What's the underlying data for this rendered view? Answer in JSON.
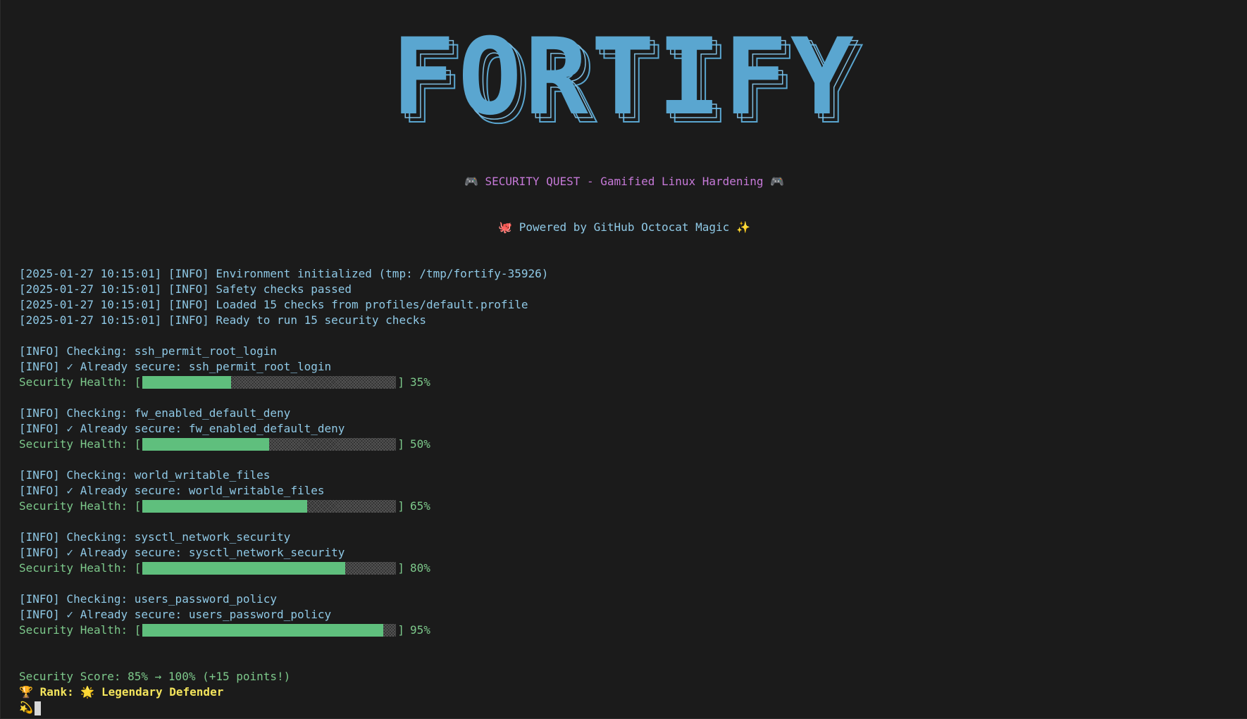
{
  "banner": {
    "title": "FORTIFY"
  },
  "subtitle": {
    "quest_icon_left": "🎮",
    "quest_text": "SECURITY QUEST - Gamified Linux Hardening",
    "quest_icon_right": "🎮",
    "powered_icon_left": "🐙",
    "powered_text": "Powered by GitHub Octocat Magic",
    "powered_icon_right": "✨"
  },
  "init_logs": [
    "[2025-01-27 10:15:01] [INFO] Environment initialized (tmp: /tmp/fortify-35926)",
    "[2025-01-27 10:15:01] [INFO] Safety checks passed",
    "[2025-01-27 10:15:01] [INFO] Loaded 15 checks from profiles/default.profile",
    "[2025-01-27 10:15:01] [INFO] Ready to run 15 security checks"
  ],
  "health_label": "Security Health: [",
  "health_close": "]",
  "checks": [
    {
      "checking": "[INFO] Checking: ssh_permit_root_login",
      "secure": "[INFO] ✓ Already secure: ssh_permit_root_login",
      "percent_text": "35%",
      "fill": 0.35
    },
    {
      "checking": "[INFO] Checking: fw_enabled_default_deny",
      "secure": "[INFO] ✓ Already secure: fw_enabled_default_deny",
      "percent_text": "50%",
      "fill": 0.5
    },
    {
      "checking": "[INFO] Checking: world_writable_files",
      "secure": "[INFO] ✓ Already secure: world_writable_files",
      "percent_text": "65%",
      "fill": 0.65
    },
    {
      "checking": "[INFO] Checking: sysctl_network_security",
      "secure": "[INFO] ✓ Already secure: sysctl_network_security",
      "percent_text": "80%",
      "fill": 0.8
    },
    {
      "checking": "[INFO] Checking: users_password_policy",
      "secure": "[INFO] ✓ Already secure: users_password_policy",
      "percent_text": "95%",
      "fill": 0.95
    }
  ],
  "score": {
    "text": "Security Score: 85% → 100% (+15 points!)"
  },
  "rank": {
    "trophy_icon": "🏆",
    "label": "Rank:",
    "star_icon": "🌟",
    "value": "Legendary Defender"
  },
  "prompt": {
    "icon": "💫"
  },
  "colors": {
    "background": "#1b1b1b",
    "info": "#8fc9e6",
    "ok": "#7dc98b",
    "bar_fill": "#5fbf7d",
    "quest": "#c679d8",
    "rank": "#f3e45c",
    "banner": "#5aa6d0"
  },
  "icons": {
    "quest": "gamepad-icon",
    "powered": "octopus-icon",
    "sparkle": "sparkles-icon",
    "trophy": "trophy-icon",
    "star": "glowing-star-icon",
    "prompt": "dizzy-icon"
  }
}
